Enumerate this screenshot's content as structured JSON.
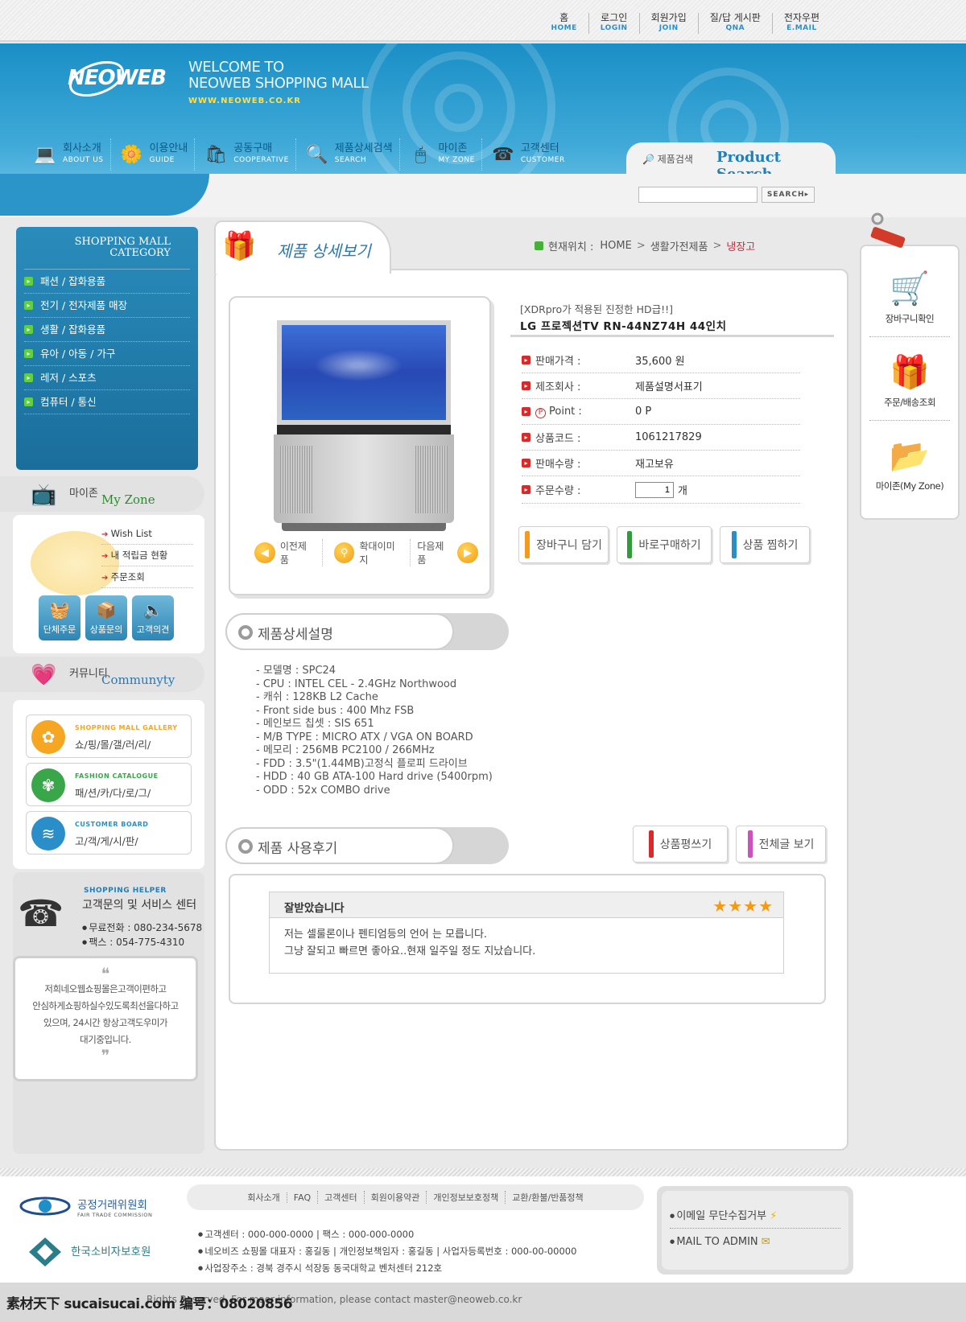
{
  "top_links": [
    {
      "ko": "홈",
      "en": "HOME"
    },
    {
      "ko": "로그인",
      "en": "LOGIN"
    },
    {
      "ko": "회원가입",
      "en": "JOIN"
    },
    {
      "ko": "질/답 게시판",
      "en": "QNA"
    },
    {
      "ko": "전자우편",
      "en": "E.MAIL"
    }
  ],
  "header": {
    "logo": "NEOWEB",
    "welcome_line1": "WELCOME TO",
    "welcome_line2": "NEOWEB SHOPPING MALL",
    "url": "WWW.NEOWEB.CO.KR"
  },
  "gnb": [
    {
      "ko": "회사소개",
      "en": "ABOUT US",
      "icon": "monitor-icon"
    },
    {
      "ko": "이용안내",
      "en": "GUIDE",
      "icon": "flower-icon"
    },
    {
      "ko": "공동구매",
      "en": "COOPERATIVE",
      "icon": "cart-icon"
    },
    {
      "ko": "제품상세검색",
      "en": "SEARCH",
      "icon": "magnifier-icon"
    },
    {
      "ko": "마이존",
      "en": "MY ZONE",
      "icon": "mouse-icon"
    },
    {
      "ko": "고객센터",
      "en": "CUSTOMER",
      "icon": "phone-icon"
    }
  ],
  "search": {
    "label": "제품검색",
    "title": "Product Search",
    "button": "SEARCH▸",
    "placeholder": ""
  },
  "category": {
    "title_line1": "SHOPPING MALL",
    "title_line2": "CATEGORY",
    "items": [
      "패션 / 잡화용품",
      "전기 / 전자제품 매장",
      "생활 / 잡화용품",
      "유아 / 아동 / 가구",
      "레저 / 스포츠",
      "컴퓨터 / 통신"
    ]
  },
  "myzone": {
    "kor": "마이존",
    "eng": "My Zone",
    "links": [
      "Wish List",
      "내 적립금 현황",
      "주문조회"
    ],
    "buttons": [
      "단체주문",
      "상품문의",
      "고객의견"
    ]
  },
  "community": {
    "kor": "커뮤니티",
    "eng": "Communyty",
    "items": [
      {
        "en": "SHOPPING MALL GALLERY",
        "ko": "쇼/핑/몰/갤/러/리/",
        "color": "#f5a623"
      },
      {
        "en": "FASHION CATALOGUE",
        "ko": "패/션/카/다/로/그/",
        "color": "#3aa64a"
      },
      {
        "en": "CUSTOMER BOARD",
        "ko": "고/객/게/시/판/",
        "color": "#2a8fc8"
      }
    ]
  },
  "helper": {
    "title": "SHOPPING HELPER",
    "name": "고객문의 및 서비스 센터",
    "phone": "무료전화 : 080-234-5678",
    "fax": "팩스 : 054-775-4310",
    "quote_lines": [
      "저희네오웹쇼핑몰은고객이편하고",
      "안심하게쇼핑하실수있도록최선을다하고",
      "있으며, 24시간 항상고객도우미가",
      "대기중입니다."
    ]
  },
  "page": {
    "title": "제품 상세보기",
    "crumb_label": "현재위치 :",
    "crumb": [
      "HOME",
      "생활가전제품",
      "냉장고"
    ]
  },
  "product": {
    "subtitle": "[XDRpro가 적용된 진정한 HD급!!]",
    "name": "LG 프로젝션TV RN-44NZ74H 44인치",
    "specs": [
      {
        "k": "판매가격 :",
        "v": "35,600 원"
      },
      {
        "k": "제조회사 :",
        "v": "제품설명서표기"
      },
      {
        "k": "Point :",
        "v": "0 P"
      },
      {
        "k": "상품코드 :",
        "v": "1061217829"
      },
      {
        "k": "판매수량 :",
        "v": "재고보유"
      }
    ],
    "qty_label": "주문수량 :",
    "qty_value": "1",
    "qty_unit": "개",
    "nav": [
      "이전제품",
      "확대이미지",
      "다음제품"
    ],
    "buttons": [
      {
        "label": "장바구니 담기",
        "color": "#f29b1d"
      },
      {
        "label": "바로구매하기",
        "color": "#2f9e3a"
      },
      {
        "label": "상품 찜하기",
        "color": "#2a8fc8"
      }
    ]
  },
  "description": {
    "title": "제품상세설명",
    "lines": [
      "- 모델명 : SPC24",
      "- CPU : INTEL CEL - 2.4GHz Northwood",
      "- 캐쉬 : 128KB L2 Cache",
      "- Front side bus : 400 Mhz FSB",
      "- 메인보드 칩셋 : SIS 651",
      "- M/B TYPE  : MICRO ATX / VGA ON BOARD",
      "- 메모리 : 256MB PC2100 / 266MHz",
      "- FDD : 3.5\"(1.44MB)고정식 플로피 드라이브",
      "- HDD : 40 GB  ATA-100 Hard drive (5400rpm)",
      "- ODD : 52x COMBO drive"
    ]
  },
  "reviews": {
    "title": "제품 사용후기",
    "write_btn": "상품평쓰기",
    "all_btn": "전체글 보기",
    "write_color": "#d82a2a",
    "all_color": "#d04fbf",
    "items": [
      {
        "title": "잘받았습니다",
        "stars": 4,
        "body1": "저는 셀룰론이나 펜티엄등의 언어 는 모릅니다.",
        "body2": "그냥 잘되고 빠르면 좋아요..현재 일주일 정도 지났습니다."
      }
    ]
  },
  "quick": [
    "장바구니확인",
    "주문/배송조회",
    "마이존(My Zone)"
  ],
  "footer": {
    "ftc_name": "공정거래위원회",
    "ftc_eng": "FAIR TRADE COMMISSION",
    "kca_name": "한국소비자보호원",
    "nav": [
      "회사소개",
      "FAQ",
      "고객센터",
      "회원이용약관",
      "개인정보보호정책",
      "교환/환불/반품정책"
    ],
    "info1": "고객센터 : 000-000-0000   |   팩스 : 000-000-0000",
    "info2": "네오비즈 쇼핑몰 대표자 : 홍길동   |   개인정보책임자 : 홍길동   |   사업자등록번호 : 000-00-00000",
    "info3": "사업장주소 : 경북 경주시 석장동 동국대학교 벤처센터 212호",
    "box_link1": "이메일 무단수집거부",
    "box_link2": "MAIL TO ADMIN",
    "copyright": "Rights Reserved.  For maor information, please contact master@neoweb.co.kr",
    "watermark": "素材天下 sucaisucai.com  编号：08020856"
  }
}
